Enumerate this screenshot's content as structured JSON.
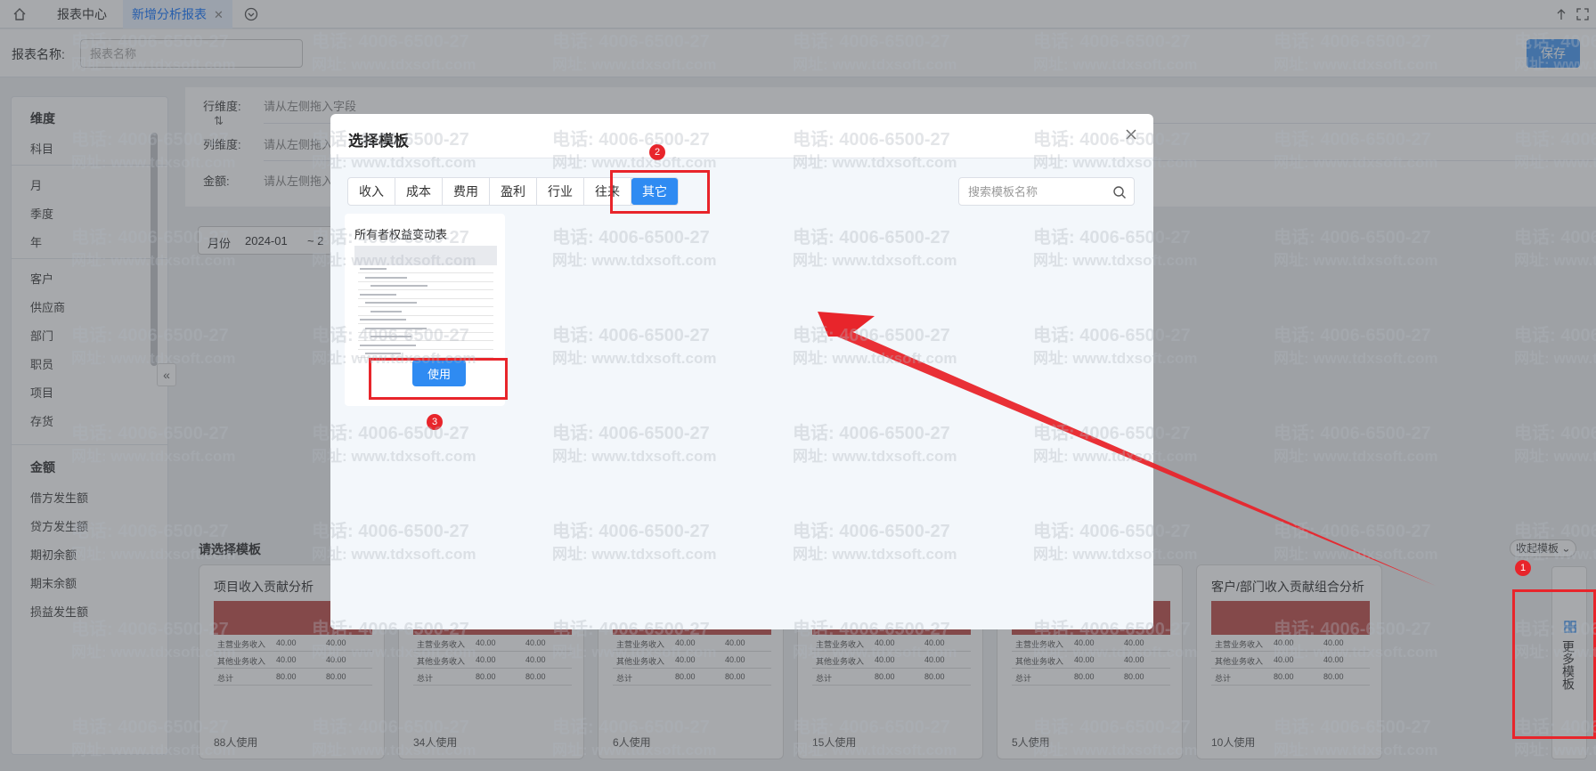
{
  "tabs": {
    "home": "报表中心",
    "active": "新增分析报表"
  },
  "report_name": {
    "label": "报表名称:",
    "placeholder": "报表名称"
  },
  "save_label": "保存",
  "left_panel": {
    "group_dimension": "维度",
    "dim_items": [
      "科目",
      "月",
      "季度",
      "年",
      "客户",
      "供应商",
      "部门",
      "职员",
      "项目",
      "存货"
    ],
    "group_amount": "金额",
    "amount_items": [
      "借方发生额",
      "贷方发生额",
      "期初余额",
      "期末余额",
      "损益发生额"
    ]
  },
  "dims": {
    "row_label": "行维度:",
    "col_label": "列维度:",
    "amount_label": "金额:",
    "hint": "请从左侧拖入字段",
    "hint_short": "请从左侧拖入"
  },
  "date_filter": {
    "label": "月份",
    "start": "2024-01",
    "sep": "~ 2"
  },
  "templates": {
    "title": "请选择模板",
    "collapse_label": "收起模板",
    "more_label": "更多模板",
    "cards": [
      {
        "name": "项目收入贡献分析",
        "users": "88人使用"
      },
      {
        "name": "",
        "users": "34人使用"
      },
      {
        "name": "",
        "users": "6人使用"
      },
      {
        "name": "",
        "users": "15人使用"
      },
      {
        "name": "析",
        "users": "5人使用"
      },
      {
        "name": "客户/部门收入贡献组合分析",
        "users": "10人使用"
      }
    ],
    "mini_rows": [
      {
        "a": "主营业务收入",
        "b": "40.00",
        "c": "40.00"
      },
      {
        "a": "其他业务收入",
        "b": "40.00",
        "c": "40.00"
      },
      {
        "a": "总计",
        "b": "80.00",
        "c": "80.00"
      }
    ]
  },
  "modal": {
    "title": "选择模板",
    "categories": [
      "收入",
      "成本",
      "费用",
      "盈利",
      "行业",
      "往来",
      "其它"
    ],
    "active_category": "其它",
    "search_placeholder": "搜索模板名称",
    "card": {
      "name": "所有者权益变动表",
      "use_label": "使用"
    }
  },
  "annotations": [
    "1",
    "2",
    "3"
  ],
  "watermark": {
    "phone": "电话: 4006-6500-27",
    "site": "网址: www.tdxsoft.com"
  },
  "colors": {
    "accent": "#2f8bf2",
    "annotation": "#e8252b",
    "template_header": "#c0504d"
  }
}
